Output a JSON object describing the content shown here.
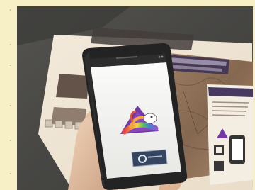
{
  "photo": {
    "caption": "",
    "colors": {
      "desk": "#3f3e3a",
      "paper": "#efe2cf",
      "map": "#8d6b51",
      "phone_body": "#1b1b1b",
      "phone_screen": "#f3f3f1",
      "app_button": "#2b3c58",
      "skin": "#e8c3a4",
      "frame": "#f7efc5"
    }
  },
  "phone": {
    "status_text": "",
    "app_logo": "triangle-rainbow-logo-icon",
    "button_label": ""
  }
}
